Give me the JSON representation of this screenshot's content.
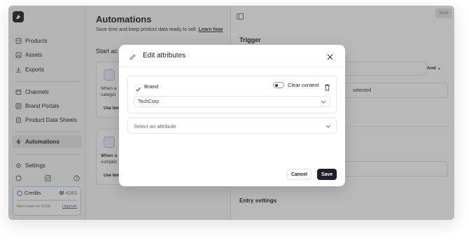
{
  "sidebar": {
    "items": [
      {
        "label": "Products",
        "icon": "box-icon"
      },
      {
        "label": "Assets",
        "icon": "image-icon"
      },
      {
        "label": "Exports",
        "icon": "download-icon"
      },
      {
        "label": "Channels",
        "icon": "channels-icon"
      },
      {
        "label": "Brand Portals",
        "icon": "portal-icon"
      },
      {
        "label": "Product Data Sheets",
        "icon": "sheet-icon"
      },
      {
        "label": "Automations",
        "icon": "lightning-icon",
        "active": true
      },
      {
        "label": "Settings",
        "icon": "gear-icon"
      }
    ],
    "credits": {
      "label": "Credits",
      "used": "0/",
      "total": "4283",
      "reset": "Next reset on 01/05",
      "upgrade": "Upgrade"
    }
  },
  "main": {
    "title": "Automations",
    "subtitle": "Save time and keep product data ready to sell.",
    "learn_link": "Learn how",
    "section": "Start ac",
    "cards": [
      {
        "line1": "When a",
        "line2": "categor",
        "button": "Use tem"
      },
      {
        "line1": "When a",
        "line2": "complet",
        "button": "Use tem"
      }
    ]
  },
  "right_panel": {
    "save_label": "Save",
    "trigger_title": "Trigger",
    "and_label": "And",
    "selected_text": "selected",
    "entry_settings": "Entry settings"
  },
  "modal": {
    "title": "Edit attributes",
    "attribute": {
      "name": "Brand",
      "clear_label": "Clear content",
      "value": "TechCorp"
    },
    "add_placeholder": "Select an attribute",
    "cancel_label": "Cancel",
    "save_label": "Save"
  },
  "colors": {
    "primary_dark": "#1e1e2a",
    "accent": "#4b5bd6",
    "overlay": "rgba(60,60,60,0.36)"
  }
}
